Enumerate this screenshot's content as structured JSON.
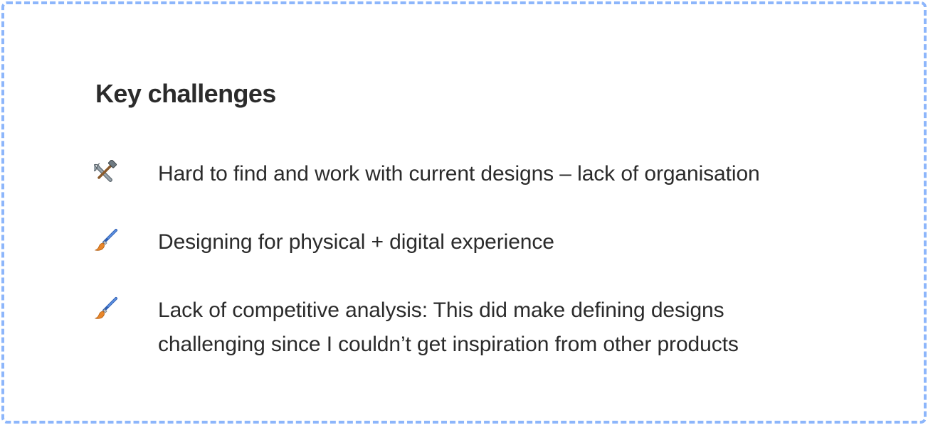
{
  "section": {
    "title": "Key challenges"
  },
  "challenges": [
    {
      "icon": "hammer-wrench-icon",
      "text": "Hard to find and work with current designs – lack of organisation"
    },
    {
      "icon": "paintbrush-icon",
      "text": "Designing for physical + digital experience"
    },
    {
      "icon": "paintbrush-icon",
      "text": "Lack of competitive analysis: This did make defining designs\nchallenging since I couldn’t get inspiration from other products"
    }
  ],
  "colors": {
    "border": "#8db6fb",
    "text": "#2b2b2b",
    "background": "#ffffff"
  }
}
